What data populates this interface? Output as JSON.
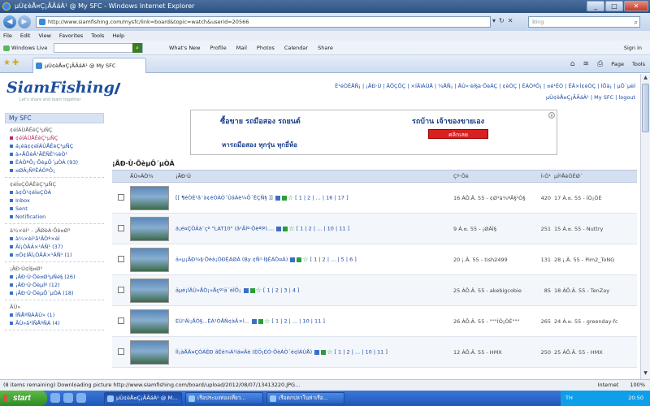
{
  "window": {
    "title": "µÙ¢èÅ¤Ç¡ÃÃáÀ¹ @ My SFC - Windows Internet Explorer",
    "controls": [
      "_",
      "□",
      "✕"
    ]
  },
  "addressbar": {
    "url": "http://www.siamfishing.com/mysfc/link=board&topic=watch&userid=20566",
    "search_placeholder": "Bing"
  },
  "menu": [
    "File",
    "Edit",
    "View",
    "Favorites",
    "Tools",
    "Help"
  ],
  "wlbar": {
    "brand": "Windows Live",
    "links": [
      "What's New",
      "Profile",
      "Mail",
      "Photos",
      "Calendar",
      "Share"
    ],
    "signin": "Sign in"
  },
  "tabbar": {
    "tab_label": "µÙ¢èÅ¤Ç¡ÃÃáÀ¹ @ My SFC",
    "page_menu": "Page",
    "tools_menu": "Tools"
  },
  "site": {
    "logo": "SiamFishing",
    "tagline": "Let's share and learn together",
    "topnav": "Ë¹éÒËÅÑ¡ | ¡ÃÐ·Ù | ÃÕÇÔÇ | ×ÍÃìÁÙÅ | ¼ÅÑ¡ | ÃÙ»·èÍ§à·ÕèÂÇ | ¢èÒÇ | ÊÁÒªÔ¡ | ¤é¹ËÒ | ËÃ×Í¢èÒÇ | ÍÕà¡ | µÔ´µèÍ",
    "topnav2": "µÙ¢èÅ¤Ç¡ÃÃáÀ¹ | My SFC | logout"
  },
  "sidebar": {
    "header": "My SFC",
    "sections": [
      {
        "title": "¢éÍÁÙÅÊèÇ¹µÑÇ",
        "items": [
          {
            "label": "¢éÍÁÙÅÊèÇ¹µÑÇ",
            "pink": true
          },
          {
            "label": "á¡éä¢¢éÍÁÙÅÊèÇ¹µÑÇ",
            "pink": false
          },
          {
            "label": "à»ÅÕèÂ¹ÃËÑÊ¼èÒ¹",
            "pink": false
          },
          {
            "label": "ÊÁÒªÔ¡·ÕèµÔ´µÒÁ (93)",
            "pink": false
          },
          {
            "label": "¤ØÂ¡ÑºÊÁÒªÔ¡",
            "pink": false
          }
        ]
      },
      {
        "title": "¢éÍ¤ÇÒÁÊèÇ¹µÑÇ",
        "items": [
          {
            "label": "à¢Õ¹¢éÍ¤ÇÒÁ",
            "pink": false
          },
          {
            "label": "Inbox",
            "pink": false
          },
          {
            "label": "Sent",
            "pink": false
          },
          {
            "label": "Notification",
            "pink": false
          }
        ]
      },
      {
        "title": "à¾×èÍ¹ - ¡ÅØèÁ·Õè¤Ø³",
        "items": [
          {
            "label": "à¾×èÍ¹ã¹ÃÒª×èÍ",
            "pink": false
          },
          {
            "label": "ÃÍ¡ÒÃÂ×¹ÂÑ¹ (37)",
            "pink": false
          },
          {
            "label": "¤Ó¢ÍÃÍ¡ÒÃÂ×¹ÂÑ¹ (1)",
            "pink": false
          }
        ]
      },
      {
        "title": "¡ÃÐ·Ù¢Í§¤Ø³",
        "items": [
          {
            "label": "¡ÃÐ·Ù·Õè¤Ø³µÑé§ (26)",
            "pink": false
          },
          {
            "label": "¡ÃÐ·Ù·ÕèµÍº (12)",
            "pink": false
          },
          {
            "label": "¡ÃÐ·Ù·ÕèµÔ´µÒÁ (18)",
            "pink": false
          }
        ]
      },
      {
        "title": "ÃÙ»",
        "items": [
          {
            "label": "ÍÑÅºÑÁÃÙ» (1)",
            "pink": false
          },
          {
            "label": "ÃÙ»ã¹ÍÑÅºÑÁ (4)",
            "pink": false
          }
        ]
      }
    ]
  },
  "ad": {
    "line1": "ซื้อขาย รถมือสอง รถยนต์",
    "line2": "หารถมือสอง ทุกรุ่น ทุกยี่ห้อ",
    "right_text": "รถบ้าน เจ้าของขายเอง",
    "button": "คลิกเลย",
    "close": "x"
  },
  "board": {
    "title": "¡ÃÐ·Ù·ÕèµÔ´µÒÁ",
    "columns": [
      "ÃÙ»ÀÒ¾",
      "¡ÃÐ·Ù",
      "Çº·Õè",
      "Í‹Ò¹",
      "µÍºÅèÒÊØ´"
    ],
    "rows": [
      {
        "title": "[[ ¶éÒÊ¹ã¨à¢éÒÁÒ´ÙäÁè¼Ô´ËÇÑ§ ]]",
        "pages": "[ 1 | 2 | ... | 16 | 17 ]",
        "date": "16 ÁÔ.Â. 55 - ¢Ø¹à¾ªÃ§¹Ò§",
        "views": "420",
        "last": "17 Á.¤. 55 - ÍÒ¡ÒÈ"
      },
      {
        "title": "á¡é¤ÇÒÁà¨çº \"LAT10\" (ã¹ÃÍº·ÕèªÍº)....",
        "pages": "[ 1 | 2 | ... | 10 | 11 ]",
        "date": "9 Á.¤. 55 - ¡ØÂÍ§",
        "views": "251",
        "last": "15 Á.¤. 55 - Nuttry"
      },
      {
        "title": "ä»µ¡ÃÐ¾§·Õèà¡ÒÐÊÁØÂ (By ¢Ñ¹·Í§ÊÁÒ¤Á)",
        "pages": "[ 1 | 2 | ... | 5 | 6 ]",
        "date": "20 ¡.Â. 55 - tish2499",
        "views": "131",
        "last": "28 ¡.Â. 55 - Pim2_ToNG"
      },
      {
        "title": "äµé¡ÍÃÙ»ÅÒ¡»Åçº¹ä´éÍÔ¡",
        "pages": "[ 1 | 2 | 3 | 4 ]",
        "date": "25 ÁÔ.Â. 55 - akebigcobie",
        "views": "85",
        "last": "18 ÁÔ.Â. 55 - TenZay"
      },
      {
        "title": "ÈÙ¹Âì¡ÅÒ§...ÊÁ¹ÒÅÑ¢àÃ×Í...",
        "pages": "[ 1 | 2 | ... | 10 | 11 ]",
        "date": "26 ÁÔ.Â. 55 - \"\"\"ÍÒ¡ÒÈ\"\"\"",
        "views": "265",
        "last": "24 Á.¤. 55 - greenday-fc"
      },
      {
        "title": "ÍÍ¡àÅÂ¤ÇÒÁÊÐ ãÊè¾Á¹ìá¤Ãè (ÈÖ¡ÉÒ·ÕèÁÒ´é¢ÍÁÙÅ)",
        "pages": "[ 1 | 2 | ... | 10 | 11 ]",
        "date": "12 ÁÔ.Â. 55 - HMX",
        "views": "250",
        "last": "25 ÁÔ.Â. 55 - HMX"
      }
    ]
  },
  "status": {
    "text": "(8 items remaining) Downloading picture http://www.siamfishing.com/board/upload/2012/08/07/13413220.JPG...",
    "zone": "Internet",
    "zoom": "100%"
  },
  "taskbar": {
    "start": "start",
    "tasks": [
      "µÙ¢èÅ¤Ç¡ÃÃáÀ¹ @ M...",
      "เรือประมงท่องเที่ยว...",
      "เรือตกปลาในท่าเรือ..."
    ],
    "lang": "TH",
    "clock": "20:50"
  }
}
